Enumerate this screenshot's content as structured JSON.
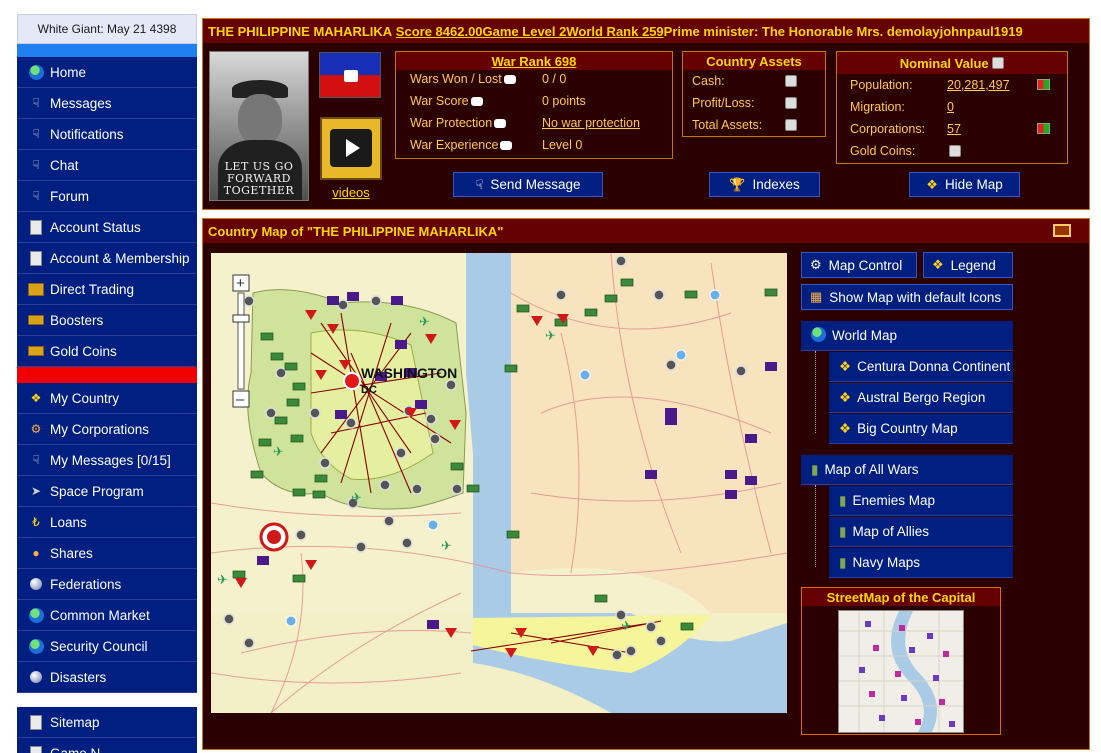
{
  "sidebar": {
    "date_text": "White Giant: May 21 4398",
    "items_group1": [
      {
        "label": "Home",
        "icon": "globe-icon"
      },
      {
        "label": "Messages",
        "icon": "antenna-icon"
      },
      {
        "label": "Notifications",
        "icon": "antenna-icon"
      },
      {
        "label": "Chat",
        "icon": "antenna-icon"
      },
      {
        "label": "Forum",
        "icon": "antenna-icon"
      },
      {
        "label": "Account Status",
        "icon": "document-icon"
      },
      {
        "label": "Account & Membership",
        "icon": "document-icon"
      },
      {
        "label": "Direct Trading",
        "icon": "gold-stack-icon"
      },
      {
        "label": "Boosters",
        "icon": "gold-bar-icon"
      },
      {
        "label": "Gold Coins",
        "icon": "gold-bar-icon"
      }
    ],
    "items_group2": [
      {
        "label": "My Country",
        "icon": "eagle-icon"
      },
      {
        "label": "My Corporations",
        "icon": "gear-icon"
      },
      {
        "label": "My Messages [0/15]",
        "icon": "antenna-icon"
      },
      {
        "label": "Space Program",
        "icon": "rocket-icon"
      },
      {
        "label": "Loans",
        "icon": "money-icon"
      },
      {
        "label": "Shares",
        "icon": "share-icon"
      },
      {
        "label": "Federations",
        "icon": "sphere-icon"
      },
      {
        "label": "Common Market",
        "icon": "globe-icon"
      },
      {
        "label": "Security Council",
        "icon": "globe-icon"
      },
      {
        "label": "Disasters",
        "icon": "sphere-icon"
      }
    ],
    "items_group3": [
      {
        "label": "Sitemap",
        "icon": "document-icon"
      },
      {
        "label": "Game N",
        "icon": "document-icon"
      }
    ]
  },
  "header": {
    "country_name": "THE PHILIPPINE MAHARLIKA",
    "score": "Score 8462.00",
    "game_level": "Game Level 2",
    "world_rank": "World Rank 259",
    "prime_minister": "Prime minister: The Honorable Mrs. demolayjohnpaul1919",
    "portrait_caption": "LET US GO FORWARD TOGETHER",
    "videos_label": "videos"
  },
  "war": {
    "title": "War Rank 698",
    "rows": [
      {
        "label": "Wars Won / Lost",
        "value": "0 / 0",
        "link": false
      },
      {
        "label": "War Score",
        "value": "0 points",
        "link": false
      },
      {
        "label": "War Protection",
        "value": "No war protection",
        "link": true
      },
      {
        "label": "War Experience",
        "value": "Level 0",
        "link": false
      }
    ]
  },
  "assets": {
    "title": "Country Assets",
    "rows": [
      {
        "label": "Cash:"
      },
      {
        "label": "Profit/Loss:"
      },
      {
        "label": "Total Assets:"
      }
    ]
  },
  "nominal": {
    "title": "Nominal Value",
    "rows": [
      {
        "label": "Population:",
        "value": "20,281,497"
      },
      {
        "label": "Migration:",
        "value": "0"
      },
      {
        "label": "Corporations:",
        "value": "57"
      },
      {
        "label": "Gold Coins:",
        "value": ""
      }
    ]
  },
  "actions": {
    "send_message": "Send Message",
    "indexes": "Indexes",
    "hide_map": "Hide Map"
  },
  "map_panel": {
    "title": "Country Map of \"THE PHILIPPINE MAHARLIKA\"",
    "city_label": "WASHINGTON",
    "city_sublabel": "DC",
    "map_control": "Map Control",
    "legend": "Legend",
    "default_icons": "Show Map with default Icons",
    "world_map": "World Map",
    "world_children": [
      "Centura Donna Continent",
      "Austral Bergo Region",
      "Big Country Map"
    ],
    "wars_map": "Map of All Wars",
    "wars_children": [
      "Enemies Map",
      "Map of Allies",
      "Navy Maps"
    ],
    "streetmap_title": "StreetMap of the Capital"
  },
  "colors": {
    "nav_blue": "#001f80",
    "panel_bg": "#2a0000",
    "panel_head": "#660000",
    "gold_text": "#ffd700",
    "accent_red": "#f00000",
    "accent_blue": "#1f7ff0"
  }
}
